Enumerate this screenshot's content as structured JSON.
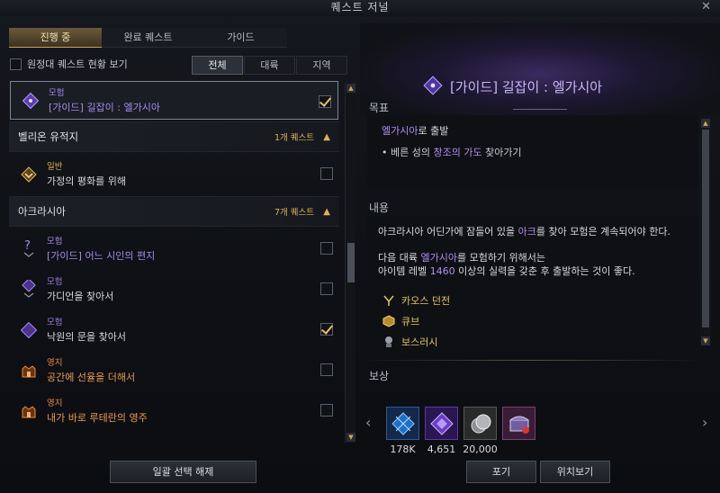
{
  "window": {
    "title": "퀘스트 저널",
    "close": "✕"
  },
  "tabs": [
    {
      "label": "진행 중",
      "active": true
    },
    {
      "label": "완료 퀘스트",
      "active": false
    },
    {
      "label": "가이드",
      "active": false
    }
  ],
  "expedition_label": "원정대 퀘스트 현황 보기",
  "filters": [
    {
      "label": "전체",
      "active": true
    },
    {
      "label": "대륙",
      "active": false
    },
    {
      "label": "지역",
      "active": false
    }
  ],
  "pinned_quest": {
    "category": "모험",
    "name": "[가이드] 길잡이 : 엘가시아",
    "checked": true,
    "icon": "guide-diamond-icon"
  },
  "sections": [
    {
      "name": "벨리온 유적지",
      "count": "1개 퀘스트",
      "quests": [
        {
          "category": "일반",
          "name": "가정의 평화를 위해",
          "checked": false,
          "icon": "normal-quest-icon",
          "style": "normal"
        }
      ]
    },
    {
      "name": "아크라시아",
      "count": "7개 퀘스트",
      "quests": [
        {
          "category": "모험",
          "name": "[가이드] 어느 시인의 편지",
          "checked": false,
          "icon": "question-mark-icon",
          "style": "guide"
        },
        {
          "category": "모험",
          "name": "가디언을 찾아서",
          "checked": false,
          "icon": "adventure-diamond-icon",
          "style": "adv"
        },
        {
          "category": "모험",
          "name": "낙원의 문을 찾아서",
          "checked": true,
          "icon": "adventure-diamond-icon",
          "style": "adv"
        },
        {
          "category": "영지",
          "name": "공간에 선율을 더해서",
          "checked": false,
          "icon": "stronghold-icon",
          "style": "land"
        },
        {
          "category": "영지",
          "name": "내가 바로 루테란의 영주",
          "checked": false,
          "icon": "stronghold-icon",
          "style": "land"
        }
      ]
    }
  ],
  "left_button": "일괄 선택 해제",
  "detail": {
    "title": "[가이드] 길잡이 : 엘가시아",
    "goal_heading": "목표",
    "goal_main_hl": "엘가시아",
    "goal_main_rest": "로 출발",
    "goal_sub_prefix": "• 베른 성의 ",
    "goal_sub_hl": "창조의 가도",
    "goal_sub_suffix": " 찾아가기",
    "content_heading": "내용",
    "content_line1_a": "아크라시아 어딘가에 잠들어 있을 ",
    "content_line1_hl": "아크",
    "content_line1_b": "를 찾아 모험은 계속되어야 한다.",
    "content_line2_a": "다음 대륙 ",
    "content_line2_hl": "엘가시아",
    "content_line2_b": "를 모험하기 위해서는",
    "content_line3_a": "아이템 레벨 ",
    "content_line3_hl": "1460",
    "content_line3_b": " 이상의 실력을 갖춘 후 출발하는 것이 좋다.",
    "places": [
      {
        "icon": "chaos-dungeon-icon",
        "label": "카오스 던전"
      },
      {
        "icon": "cube-icon",
        "label": "큐브"
      },
      {
        "icon": "boss-rush-icon",
        "label": "보스러시"
      }
    ],
    "reward_heading": "보상",
    "rewards": [
      {
        "icon": "blue-crystal-icon",
        "value": "178K"
      },
      {
        "icon": "purple-crystal-icon",
        "value": "4,651"
      },
      {
        "icon": "silver-coin-icon",
        "value": "20,000"
      },
      {
        "icon": "chest-icon",
        "value": ""
      }
    ],
    "buttons": {
      "abandon": "포기",
      "locate": "위치보기"
    }
  },
  "colors": {
    "accent_purple": "#b18df2",
    "accent_gold": "#d8b25c",
    "land_orange": "#e99a52"
  }
}
